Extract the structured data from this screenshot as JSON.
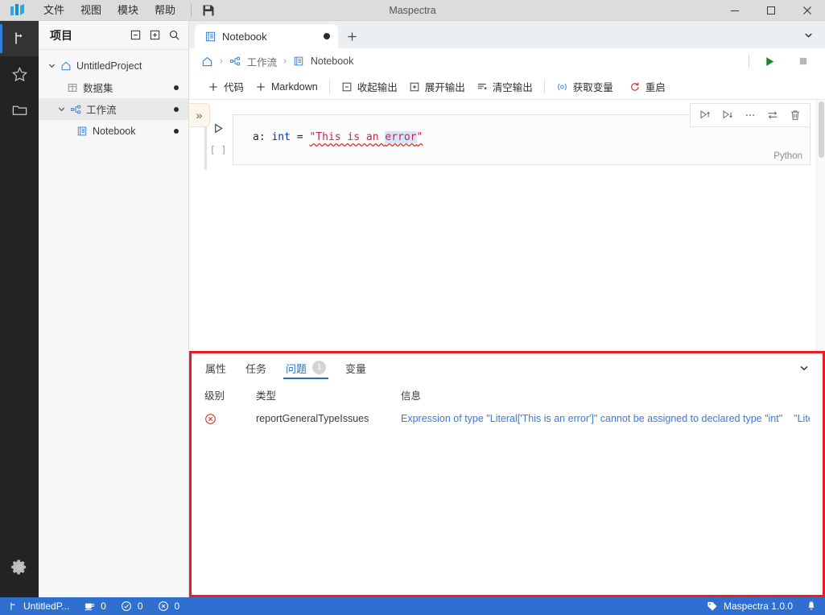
{
  "titlebar": {
    "app_logo": "maspectra-logo-icon",
    "window_title": "Maspectra",
    "menus": [
      {
        "label": "文件",
        "name": "menu-file"
      },
      {
        "label": "视图",
        "name": "menu-view"
      },
      {
        "label": "模块",
        "name": "menu-modules"
      },
      {
        "label": "帮助",
        "name": "menu-help"
      }
    ],
    "save_icon": "save-icon",
    "controls": {
      "minimize": "minimize-icon",
      "maximize": "maximize-icon",
      "close": "close-icon"
    }
  },
  "activitybar": {
    "items": [
      {
        "name": "activity-workflow",
        "icon": "branch-icon",
        "active": true
      },
      {
        "name": "activity-favorites",
        "icon": "star-icon",
        "active": false
      },
      {
        "name": "activity-files",
        "icon": "folder-icon",
        "active": false
      }
    ],
    "settings": {
      "name": "activity-settings",
      "icon": "gear-icon"
    }
  },
  "sidebar": {
    "title": "项目",
    "actions": [
      {
        "name": "collapse-all-button",
        "icon": "collapse-all-icon"
      },
      {
        "name": "expand-all-button",
        "icon": "expand-all-icon"
      },
      {
        "name": "search-button",
        "icon": "search-icon"
      }
    ],
    "tree": [
      {
        "label": "UntitledProject",
        "icon": "home-icon",
        "depth": 0,
        "chevron": "down",
        "dot": false,
        "selected": false
      },
      {
        "label": "数据集",
        "icon": "table-icon",
        "depth": 1,
        "chevron": "none",
        "dot": true,
        "selected": false
      },
      {
        "label": "工作流",
        "icon": "workflow-icon",
        "depth": 1,
        "chevron": "down",
        "dot": true,
        "selected": true
      },
      {
        "label": "Notebook",
        "icon": "notebook-icon",
        "depth": 2,
        "chevron": "none",
        "dot": true,
        "selected": false
      }
    ]
  },
  "tabstrip": {
    "tabs": [
      {
        "label": "Notebook",
        "icon": "notebook-icon",
        "dirty": true,
        "active": true
      }
    ],
    "add_tab": "plus-icon",
    "overflow": "chevron-down-icon"
  },
  "breadcrumb": {
    "home_icon": "home-icon",
    "separator": "›",
    "items": [
      {
        "label": "工作流",
        "icon": "workflow-icon"
      },
      {
        "label": "Notebook",
        "icon": "notebook-icon"
      }
    ],
    "run_button": "run-icon",
    "stop_button": "stop-icon"
  },
  "notebook_toolbar": {
    "buttons": [
      {
        "label": "代码",
        "icon": "plus-icon",
        "name": "add-code-cell-button"
      },
      {
        "label": "Markdown",
        "icon": "plus-icon",
        "name": "add-markdown-cell-button"
      },
      {
        "label": "收起输出",
        "icon": "collapse-output-icon",
        "name": "collapse-output-button"
      },
      {
        "label": "展开输出",
        "icon": "expand-output-icon",
        "name": "expand-output-button"
      },
      {
        "label": "清空输出",
        "icon": "clear-output-icon",
        "name": "clear-output-button"
      },
      {
        "label": "获取变量",
        "icon": "variables-icon",
        "name": "get-variables-button"
      },
      {
        "label": "重启",
        "icon": "restart-icon",
        "name": "restart-button"
      }
    ]
  },
  "editor": {
    "collapse_handle": "»",
    "cell": {
      "execution_count": "[ ]",
      "run_icon": "play-outline-icon",
      "language": "Python",
      "code": {
        "var": "a",
        "colon": ": ",
        "type": "int",
        "equals": " = ",
        "string_open": "\"This is an ",
        "string_selected": "error",
        "string_close": "\""
      },
      "toolbar": [
        {
          "name": "run-above-button",
          "icon": "run-above-icon"
        },
        {
          "name": "run-below-button",
          "icon": "run-below-icon"
        },
        {
          "name": "more-options-button",
          "icon": "ellipsis-icon"
        },
        {
          "name": "switch-cell-type-button",
          "icon": "swap-icon"
        },
        {
          "name": "delete-cell-button",
          "icon": "trash-icon"
        }
      ]
    }
  },
  "panel": {
    "border_color": "#ed1c24",
    "tabs": [
      {
        "label": "属性",
        "name": "tab-properties",
        "active": false,
        "badge": null
      },
      {
        "label": "任务",
        "name": "tab-tasks",
        "active": false,
        "badge": null
      },
      {
        "label": "问题",
        "name": "tab-problems",
        "active": true,
        "badge": "1"
      },
      {
        "label": "变量",
        "name": "tab-variables",
        "active": false,
        "badge": null
      }
    ],
    "collapse_icon": "chevron-down-icon",
    "columns": [
      "级别",
      "类型",
      "信息"
    ],
    "rows": [
      {
        "severity_icon": "error-circle-icon",
        "type": "reportGeneralTypeIssues",
        "message": "Expression of type \"Literal['This is an error']\" cannot be assigned to declared type \"int\"",
        "message_secondary": "\"Literal['Th…"
      }
    ]
  },
  "statusbar": {
    "project_icon": "branch-icon",
    "project": "UntitledP...",
    "metrics": [
      {
        "icon": "coffee-icon",
        "value": "0",
        "name": "kernel-count"
      },
      {
        "icon": "check-circle-icon",
        "value": "0",
        "name": "success-count"
      },
      {
        "icon": "error-circle-icon",
        "value": "0",
        "name": "error-count"
      }
    ],
    "brand_icon": "tag-icon",
    "brand": "Maspectra 1.0.0",
    "bell_icon": "bell-icon"
  }
}
